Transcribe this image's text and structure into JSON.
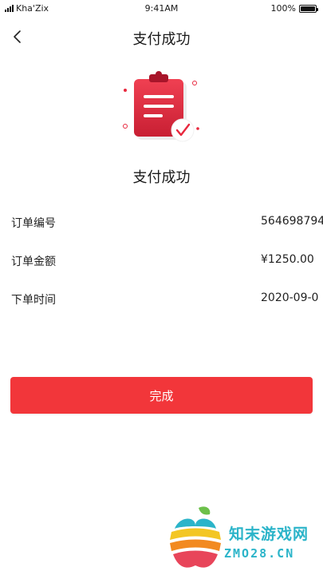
{
  "status_bar": {
    "carrier": "Kha'Zix",
    "time": "9:41AM",
    "battery": "100%",
    "battery_level": 1.0
  },
  "header": {
    "title": "支付成功",
    "back_icon": "chevron-left-icon"
  },
  "hero": {
    "icon": "clipboard-check-icon",
    "title": "支付成功",
    "accent_color": "#e8283e"
  },
  "order": {
    "rows": [
      {
        "label": "订单编号",
        "value": "564698794"
      },
      {
        "label": "订单金额",
        "value": "¥1250.00"
      },
      {
        "label": "下单时间",
        "value": "2020-09-0"
      }
    ]
  },
  "actions": {
    "done_label": "完成",
    "button_color": "#f2363a"
  },
  "watermark": {
    "text_cn": "知末游戏网",
    "text_en": "ZMO28.CN"
  }
}
